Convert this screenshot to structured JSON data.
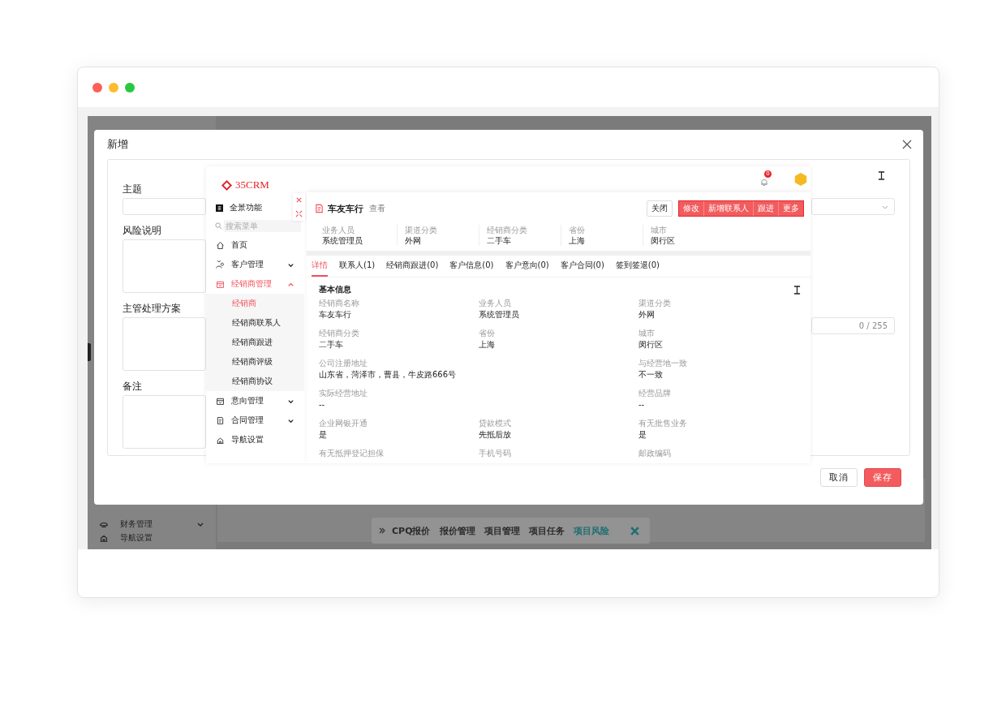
{
  "background_app": {
    "sidebar_items": [
      {
        "label": "财务管理",
        "expanded": false
      },
      {
        "label": "导航设置"
      }
    ],
    "quick_bar": [
      {
        "label": "CPQ报价",
        "selected": false
      },
      {
        "label": "报价管理",
        "selected": false
      },
      {
        "label": "项目管理",
        "selected": false
      },
      {
        "label": "项目任务",
        "selected": false
      },
      {
        "label": "项目风险",
        "selected": true
      }
    ]
  },
  "dialog": {
    "title": "新增",
    "fields": [
      {
        "label": "主题",
        "kind": "input"
      },
      {
        "label": "风险说明",
        "kind": "textarea"
      },
      {
        "label": "主管处理方案",
        "kind": "textarea"
      },
      {
        "label": "备注",
        "kind": "textarea"
      }
    ],
    "counter": "0 / 255",
    "buttons": [
      {
        "label": "取消",
        "kind": "default"
      },
      {
        "label": "保存",
        "kind": "primary"
      }
    ]
  },
  "embedded_app": {
    "logo": "35CRM",
    "notification_count": "0",
    "sidebar": {
      "panorama": "全景功能",
      "search_placeholder": "搜索菜单",
      "items": [
        {
          "label": "首页",
          "selected": false
        },
        {
          "label": "客户管理",
          "expanded": false,
          "selected": false
        },
        {
          "label": "经销商管理",
          "expanded": true,
          "selected": true,
          "children": [
            {
              "label": "经销商",
              "selected": true
            },
            {
              "label": "经销商联系人",
              "selected": false
            },
            {
              "label": "经销商跟进",
              "selected": false
            },
            {
              "label": "经销商评级",
              "selected": false
            },
            {
              "label": "经销商协议",
              "selected": false
            }
          ]
        },
        {
          "label": "意向管理",
          "expanded": false,
          "selected": false
        },
        {
          "label": "合同管理",
          "expanded": false,
          "selected": false
        },
        {
          "label": "导航设置",
          "selected": false
        }
      ]
    },
    "detail": {
      "title": "车友车行",
      "mode": "查看",
      "buttons": [
        {
          "label": "关闭",
          "kind": "plain"
        },
        {
          "label": "修改",
          "kind": "primary"
        },
        {
          "label": "新增联系人",
          "kind": "primary"
        },
        {
          "label": "跟进",
          "kind": "primary"
        },
        {
          "label": "更多",
          "kind": "primary"
        }
      ],
      "summary": [
        {
          "label": "业务人员",
          "value": "系统管理员"
        },
        {
          "label": "渠道分类",
          "value": "外网"
        },
        {
          "label": "经销商分类",
          "value": "二手车"
        },
        {
          "label": "省份",
          "value": "上海"
        },
        {
          "label": "城市",
          "value": "闵行区"
        }
      ],
      "tabs": [
        {
          "label": "详情",
          "selected": true
        },
        {
          "label": "联系人(1)",
          "selected": false
        },
        {
          "label": "经销商跟进(0)",
          "selected": false
        },
        {
          "label": "客户信息(0)",
          "selected": false
        },
        {
          "label": "客户意向(0)",
          "selected": false
        },
        {
          "label": "客户合同(0)",
          "selected": false
        },
        {
          "label": "签到签退(0)",
          "selected": false
        }
      ],
      "section_title": "基本信息",
      "fields": [
        {
          "label": "经销商名称",
          "value": "车友车行"
        },
        {
          "label": "业务人员",
          "value": "系统管理员"
        },
        {
          "label": "渠道分类",
          "value": "外网"
        },
        {
          "label": "经销商分类",
          "value": "二手车"
        },
        {
          "label": "省份",
          "value": "上海"
        },
        {
          "label": "城市",
          "value": "闵行区"
        },
        {
          "label": "公司注册地址",
          "value": "山东省，菏泽市，曹县，牛皮路666号",
          "wide": true
        },
        {
          "label": "与经营地一致",
          "value": "不一致"
        },
        {
          "label": "实际经营地址",
          "value": "--",
          "wide": true
        },
        {
          "label": "经营品牌",
          "value": "--"
        },
        {
          "label": "企业网银开通",
          "value": "是"
        },
        {
          "label": "贷款模式",
          "value": "先抵后放"
        },
        {
          "label": "有无批售业务",
          "value": "是"
        },
        {
          "label": "有无抵押登记担保"
        },
        {
          "label": "手机号码"
        },
        {
          "label": "邮政编码"
        }
      ]
    }
  }
}
